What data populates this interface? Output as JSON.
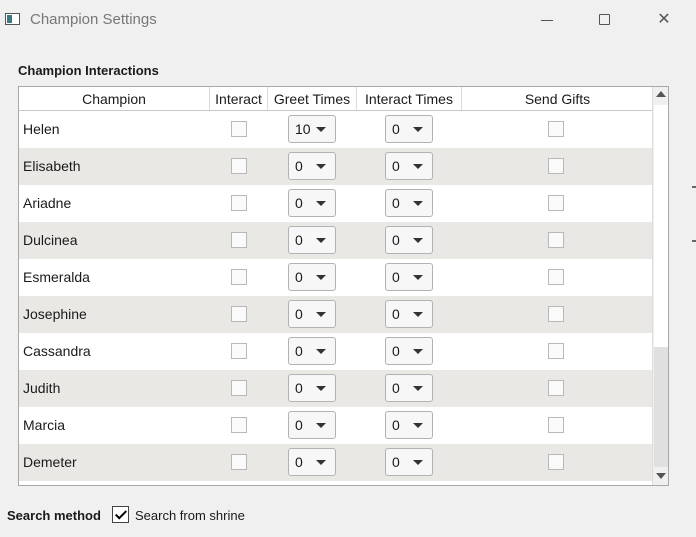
{
  "window": {
    "title": "Champion Settings"
  },
  "group": {
    "label": "Champion Interactions"
  },
  "table": {
    "columns": [
      "Champion",
      "Interact",
      "Greet Times",
      "Interact Times",
      "Send Gifts"
    ],
    "rows": [
      {
        "name": "Helen",
        "interact": false,
        "greet": "10",
        "interact_times": "0",
        "gifts": false
      },
      {
        "name": "Elisabeth",
        "interact": false,
        "greet": "0",
        "interact_times": "0",
        "gifts": false
      },
      {
        "name": "Ariadne",
        "interact": false,
        "greet": "0",
        "interact_times": "0",
        "gifts": false
      },
      {
        "name": "Dulcinea",
        "interact": false,
        "greet": "0",
        "interact_times": "0",
        "gifts": false
      },
      {
        "name": "Esmeralda",
        "interact": false,
        "greet": "0",
        "interact_times": "0",
        "gifts": false
      },
      {
        "name": "Josephine",
        "interact": false,
        "greet": "0",
        "interact_times": "0",
        "gifts": false
      },
      {
        "name": "Cassandra",
        "interact": false,
        "greet": "0",
        "interact_times": "0",
        "gifts": false
      },
      {
        "name": "Judith",
        "interact": false,
        "greet": "0",
        "interact_times": "0",
        "gifts": false
      },
      {
        "name": "Marcia",
        "interact": false,
        "greet": "0",
        "interact_times": "0",
        "gifts": false
      },
      {
        "name": "Demeter",
        "interact": false,
        "greet": "0",
        "interact_times": "0",
        "gifts": false
      }
    ]
  },
  "search": {
    "label": "Search method",
    "option_label": "Search from shrine",
    "checked": true
  },
  "icons": {
    "app": "app-window-icon",
    "minimize": "minimize-icon",
    "maximize": "maximize-icon",
    "close": "close-icon",
    "dropdown": "chevron-down-icon",
    "scroll_up": "scroll-up-arrow-icon",
    "scroll_down": "scroll-down-arrow-icon",
    "check": "checkmark-icon"
  }
}
